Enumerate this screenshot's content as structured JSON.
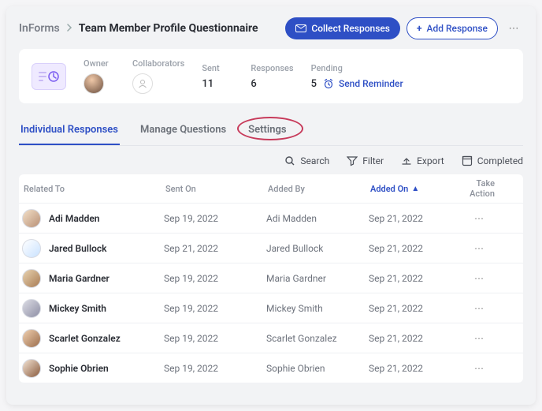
{
  "breadcrumb": {
    "root": "InForms",
    "title": "Team Member Profile Questionnaire"
  },
  "actions": {
    "collect": "Collect Responses",
    "add": "Add Response"
  },
  "stats": {
    "owner_label": "Owner",
    "collab_label": "Collaborators",
    "sent_label": "Sent",
    "sent_val": "11",
    "resp_label": "Responses",
    "resp_val": "6",
    "pending_label": "Pending",
    "pending_val": "5",
    "reminder": "Send Reminder"
  },
  "tabs": {
    "individual": "Individual Responses",
    "manage": "Manage Questions",
    "settings": "Settings"
  },
  "toolbar": {
    "search": "Search",
    "filter": "Filter",
    "export": "Export",
    "completed": "Completed"
  },
  "columns": {
    "related": "Related To",
    "sent": "Sent On",
    "added_by": "Added By",
    "added_on": "Added On",
    "action": "Take Action"
  },
  "rows": [
    {
      "name": "Adi Madden",
      "sent": "Sep 19, 2022",
      "added_by": "Adi Madden",
      "added_on": "Sep 21, 2022"
    },
    {
      "name": "Jared Bullock",
      "sent": "Sep 21, 2022",
      "added_by": "Jared Bullock",
      "added_on": "Sep 21, 2022"
    },
    {
      "name": "Maria Gardner",
      "sent": "Sep 19, 2022",
      "added_by": "Maria Gardner",
      "added_on": "Sep 21, 2022"
    },
    {
      "name": "Mickey Smith",
      "sent": "Sep 19, 2022",
      "added_by": "Mickey Smith",
      "added_on": "Sep 21, 2022"
    },
    {
      "name": "Scarlet Gonzalez",
      "sent": "Sep 19, 2022",
      "added_by": "Scarlet Gonzalez",
      "added_on": "Sep 21, 2022"
    },
    {
      "name": "Sophie Obrien",
      "sent": "Sep 19, 2022",
      "added_by": "Sophie Obrien",
      "added_on": "Sep 21, 2022"
    }
  ]
}
